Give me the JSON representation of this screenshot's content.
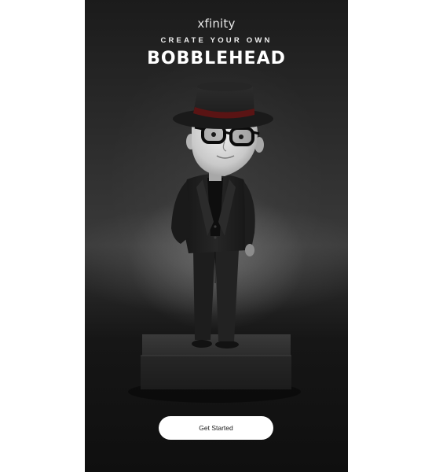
{
  "brand": {
    "logo_text": "xfinity"
  },
  "header": {
    "subtitle": "CREATE YOUR OWN",
    "title": "BOBBLEHEAD"
  },
  "cta": {
    "label": "Get Started"
  },
  "illustration": {
    "subject": "bobblehead-figure",
    "colors": {
      "background": "#1b1b1b",
      "button_bg": "#ffffff",
      "button_text": "#1a1a1a",
      "hat_band": "#5a1414"
    }
  }
}
